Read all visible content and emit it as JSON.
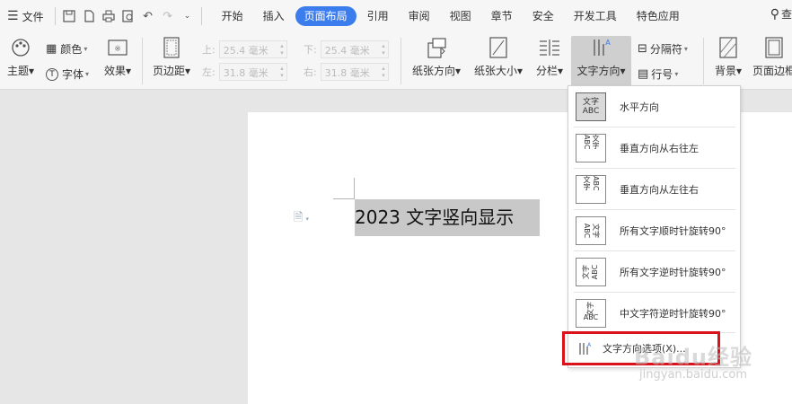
{
  "menu": {
    "file_label": "文件",
    "tabs": [
      {
        "label": "开始",
        "active": false
      },
      {
        "label": "插入",
        "active": false
      },
      {
        "label": "页面布局",
        "active": true
      },
      {
        "label": "引用",
        "active": false
      },
      {
        "label": "审阅",
        "active": false
      },
      {
        "label": "视图",
        "active": false
      },
      {
        "label": "章节",
        "active": false
      },
      {
        "label": "安全",
        "active": false
      },
      {
        "label": "开发工具",
        "active": false
      },
      {
        "label": "特色应用",
        "active": false
      }
    ],
    "search_label": "查"
  },
  "toolbar": {
    "theme": "主题",
    "color": "颜色",
    "font": "字体",
    "effect": "效果",
    "page_margin": "页边距",
    "top_label": "上:",
    "top_value": "25.4 毫米",
    "bottom_label": "下:",
    "bottom_value": "25.4 毫米",
    "left_label": "左:",
    "left_value": "31.8 毫米",
    "right_label": "右:",
    "right_value": "31.8 毫米",
    "orientation": "纸张方向",
    "paper_size": "纸张大小",
    "columns": "分栏",
    "text_direction": "文字方向",
    "separator": "分隔符",
    "line_number": "行号",
    "background": "背景",
    "page_border": "页面边框"
  },
  "document": {
    "text": "2023 文字竖向显示"
  },
  "dropdown": {
    "items": [
      {
        "label": "水平方向",
        "icon_text": "文字 ABC"
      },
      {
        "label": "垂直方向从右往左",
        "icon_text": "ABC 文字"
      },
      {
        "label": "垂直方向从左往右",
        "icon_text": "文字 ABC"
      },
      {
        "label": "所有文字顺时针旋转90°",
        "icon_text": "ABC 文字"
      },
      {
        "label": "所有文字逆时针旋转90°",
        "icon_text": "ABC 文字"
      },
      {
        "label": "中文字符逆时针旋转90°",
        "icon_text": "文字 ABC"
      }
    ],
    "more_label": "文字方向选项(X)..."
  },
  "watermark": {
    "text": "Baidu经验",
    "url": "jingyan.baidu.com"
  },
  "colors": {
    "accent": "#3b7ded",
    "highlight": "#d9121c",
    "selection": "#c8c8c8"
  }
}
